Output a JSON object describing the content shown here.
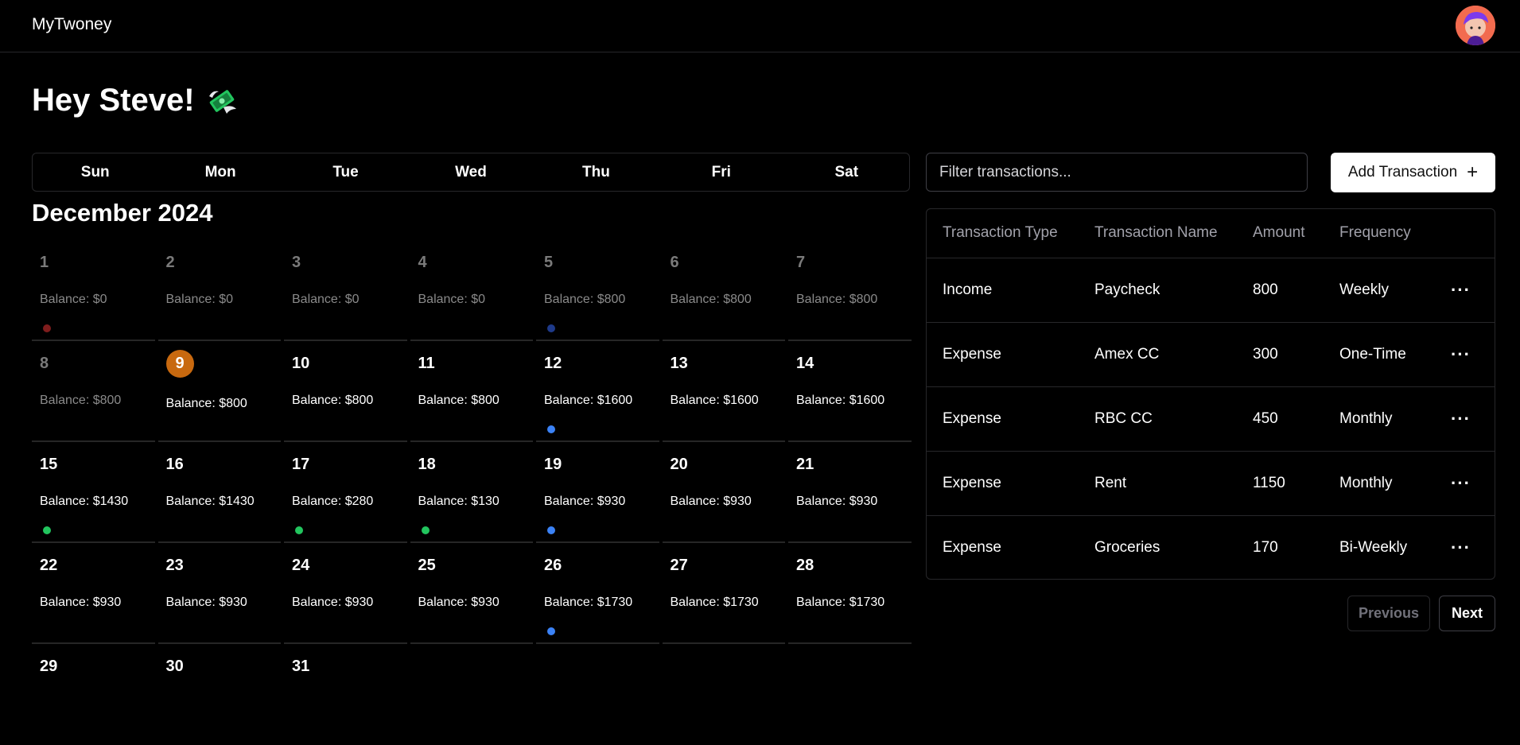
{
  "app": {
    "title": "MyTwoney"
  },
  "greeting": {
    "text": "Hey Steve!",
    "icon": "money-with-wings-icon"
  },
  "calendar": {
    "weekdays": [
      "Sun",
      "Mon",
      "Tue",
      "Wed",
      "Thu",
      "Fri",
      "Sat"
    ],
    "month_label": "December 2024",
    "today": "9",
    "today_color": "#c8690f",
    "days": [
      {
        "day": "1",
        "balance": "Balance: $0",
        "past": true,
        "dot": "#7f1d1d"
      },
      {
        "day": "2",
        "balance": "Balance: $0",
        "past": true,
        "dot": null
      },
      {
        "day": "3",
        "balance": "Balance: $0",
        "past": true,
        "dot": null
      },
      {
        "day": "4",
        "balance": "Balance: $0",
        "past": true,
        "dot": null
      },
      {
        "day": "5",
        "balance": "Balance: $800",
        "past": true,
        "dot": "#1e3a8a"
      },
      {
        "day": "6",
        "balance": "Balance: $800",
        "past": true,
        "dot": null
      },
      {
        "day": "7",
        "balance": "Balance: $800",
        "past": true,
        "dot": null
      },
      {
        "day": "8",
        "balance": "Balance: $800",
        "past": true,
        "dot": null
      },
      {
        "day": "9",
        "balance": "Balance: $800",
        "past": false,
        "dot": null,
        "today": true
      },
      {
        "day": "10",
        "balance": "Balance: $800",
        "past": false,
        "dot": null
      },
      {
        "day": "11",
        "balance": "Balance: $800",
        "past": false,
        "dot": null
      },
      {
        "day": "12",
        "balance": "Balance: $1600",
        "past": false,
        "dot": "#3b82f6"
      },
      {
        "day": "13",
        "balance": "Balance: $1600",
        "past": false,
        "dot": null
      },
      {
        "day": "14",
        "balance": "Balance: $1600",
        "past": false,
        "dot": null
      },
      {
        "day": "15",
        "balance": "Balance: $1430",
        "past": false,
        "dot": "#22c55e"
      },
      {
        "day": "16",
        "balance": "Balance: $1430",
        "past": false,
        "dot": null
      },
      {
        "day": "17",
        "balance": "Balance: $280",
        "past": false,
        "dot": "#22c55e"
      },
      {
        "day": "18",
        "balance": "Balance: $130",
        "past": false,
        "dot": "#22c55e"
      },
      {
        "day": "19",
        "balance": "Balance: $930",
        "past": false,
        "dot": "#3b82f6"
      },
      {
        "day": "20",
        "balance": "Balance: $930",
        "past": false,
        "dot": null
      },
      {
        "day": "21",
        "balance": "Balance: $930",
        "past": false,
        "dot": null
      },
      {
        "day": "22",
        "balance": "Balance: $930",
        "past": false,
        "dot": null
      },
      {
        "day": "23",
        "balance": "Balance: $930",
        "past": false,
        "dot": null
      },
      {
        "day": "24",
        "balance": "Balance: $930",
        "past": false,
        "dot": null
      },
      {
        "day": "25",
        "balance": "Balance: $930",
        "past": false,
        "dot": null
      },
      {
        "day": "26",
        "balance": "Balance: $1730",
        "past": false,
        "dot": "#3b82f6"
      },
      {
        "day": "27",
        "balance": "Balance: $1730",
        "past": false,
        "dot": null
      },
      {
        "day": "28",
        "balance": "Balance: $1730",
        "past": false,
        "dot": null
      },
      {
        "day": "29",
        "balance": "",
        "past": false,
        "dot": null
      },
      {
        "day": "30",
        "balance": "",
        "past": false,
        "dot": null
      },
      {
        "day": "31",
        "balance": "",
        "past": false,
        "dot": null
      }
    ]
  },
  "transactions": {
    "filter_placeholder": "Filter transactions...",
    "add_label": "Add Transaction",
    "columns": [
      "Transaction Type",
      "Transaction Name",
      "Amount",
      "Frequency"
    ],
    "rows": [
      {
        "type": "Income",
        "name": "Paycheck",
        "amount": "800",
        "frequency": "Weekly"
      },
      {
        "type": "Expense",
        "name": "Amex CC",
        "amount": "300",
        "frequency": "One-Time"
      },
      {
        "type": "Expense",
        "name": "RBC CC",
        "amount": "450",
        "frequency": "Monthly"
      },
      {
        "type": "Expense",
        "name": "Rent",
        "amount": "1150",
        "frequency": "Monthly"
      },
      {
        "type": "Expense",
        "name": "Groceries",
        "amount": "170",
        "frequency": "Bi-Weekly"
      }
    ],
    "row_menu_icon": "more-horizontal-icon",
    "pagination": {
      "previous": "Previous",
      "next": "Next"
    }
  }
}
